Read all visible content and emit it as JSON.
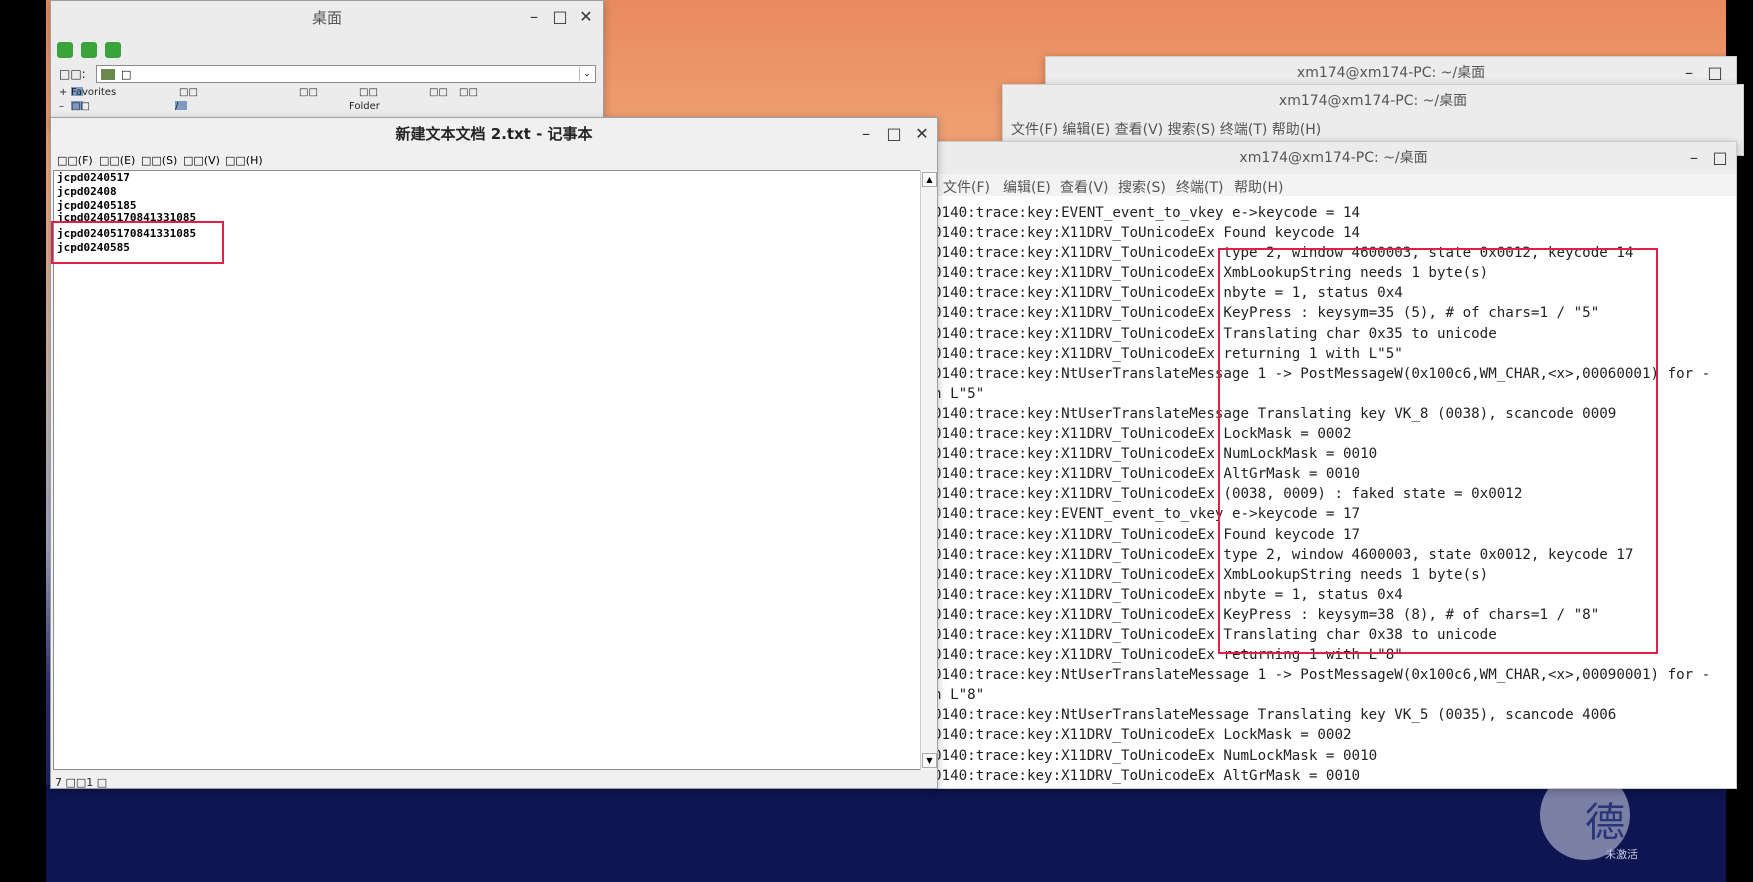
{
  "explorer": {
    "title": "桌面",
    "address_label": "□□:",
    "address_value": "□",
    "tree_rows": [
      {
        "name": "Favorites",
        "cols": [
          "□□",
          "□□",
          "□□",
          "□□",
          "□□"
        ]
      },
      {
        "name": "□□",
        "cols": [
          "/",
          "Folder"
        ]
      }
    ]
  },
  "notepad": {
    "title": "新建文本文档 2.txt - 记事本",
    "menu": [
      "□□(F)",
      "□□(E)",
      "□□(S)",
      "□□(V)",
      "□□(H)"
    ],
    "lines": [
      "jcpd0240517",
      "jcpd02408",
      "jcpd02405185",
      "jcpd02405170841331085",
      "jcpd02405170841331085",
      "jcpd0240585"
    ],
    "status": "7 □□1 □"
  },
  "terminals": {
    "back_title": "xm174@xm174-PC: ~/桌面",
    "mid_title": "xm174@xm174-PC: ~/桌面",
    "mid_menu": "文件(F)  编辑(E)  查看(V)  搜索(S)  终端(T)  帮助(H)",
    "front_title": "xm174@xm174-PC: ~/桌面",
    "front_menu": [
      "文件(F)",
      "编辑(E)",
      "查看(V)",
      "搜索(S)",
      "终端(T)",
      "帮助(H)"
    ],
    "lines": [
      "0140:trace:key:EVENT_event_to_vkey e->keycode = 14",
      "0140:trace:key:X11DRV_ToUnicodeEx Found keycode 14",
      "0140:trace:key:X11DRV_ToUnicodeEx type 2, window 4600003, state 0x0012, keycode 14",
      "0140:trace:key:X11DRV_ToUnicodeEx XmbLookupString needs 1 byte(s)",
      "0140:trace:key:X11DRV_ToUnicodeEx nbyte = 1, status 0x4",
      "0140:trace:key:X11DRV_ToUnicodeEx KeyPress : keysym=35 (5), # of chars=1 / \"5\"",
      "0140:trace:key:X11DRV_ToUnicodeEx Translating char 0x35 to unicode",
      "0140:trace:key:X11DRV_ToUnicodeEx returning 1 with L\"5\"",
      "0140:trace:key:NtUserTranslateMessage 1 -> PostMessageW(0x100c6,WM_CHAR,<x>,00060001) for -",
      "n L\"5\"",
      "0140:trace:key:NtUserTranslateMessage Translating key VK_8 (0038), scancode 0009",
      "0140:trace:key:X11DRV_ToUnicodeEx LockMask = 0002",
      "0140:trace:key:X11DRV_ToUnicodeEx NumLockMask = 0010",
      "0140:trace:key:X11DRV_ToUnicodeEx AltGrMask = 0010",
      "0140:trace:key:X11DRV_ToUnicodeEx (0038, 0009) : faked state = 0x0012",
      "0140:trace:key:EVENT_event_to_vkey e->keycode = 17",
      "0140:trace:key:X11DRV_ToUnicodeEx Found keycode 17",
      "0140:trace:key:X11DRV_ToUnicodeEx type 2, window 4600003, state 0x0012, keycode 17",
      "0140:trace:key:X11DRV_ToUnicodeEx XmbLookupString needs 1 byte(s)",
      "0140:trace:key:X11DRV_ToUnicodeEx nbyte = 1, status 0x4",
      "0140:trace:key:X11DRV_ToUnicodeEx KeyPress : keysym=38 (8), # of chars=1 / \"8\"",
      "0140:trace:key:X11DRV_ToUnicodeEx Translating char 0x38 to unicode",
      "0140:trace:key:X11DRV_ToUnicodeEx returning 1 with L\"8\"",
      "0140:trace:key:NtUserTranslateMessage 1 -> PostMessageW(0x100c6,WM_CHAR,<x>,00090001) for -",
      "n L\"8\"",
      "0140:trace:key:NtUserTranslateMessage Translating key VK_5 (0035), scancode 4006",
      "0140:trace:key:X11DRV_ToUnicodeEx LockMask = 0002",
      "0140:trace:key:X11DRV_ToUnicodeEx NumLockMask = 0010",
      "0140:trace:key:X11DRV_ToUnicodeEx AltGrMask = 0010"
    ]
  },
  "watermark": {
    "glyph": "德",
    "text": "未激活"
  },
  "colors": {
    "highlight": "#e0204a"
  }
}
